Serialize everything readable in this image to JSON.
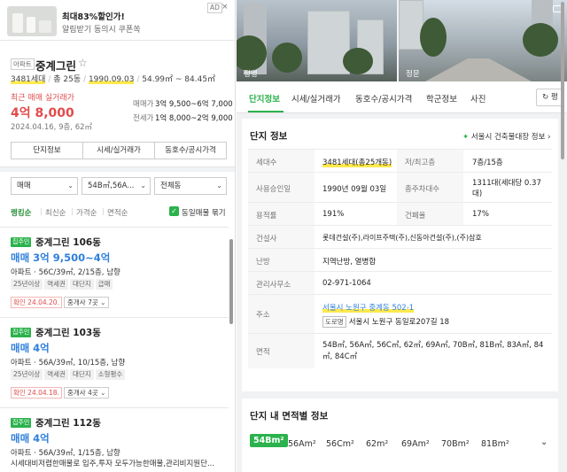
{
  "ad": {
    "title": "최대83%할인가!",
    "subtitle": "알림받기 동의시 쿠폰쏙",
    "badge": "AD",
    "close": "×"
  },
  "property": {
    "type_tag": "아파트",
    "name": "중계그린",
    "star": "☆",
    "info": {
      "households": "3481세대",
      "buildings": "총 25동",
      "approval": "1990.09.03",
      "area": "54.99㎡ ~ 84.45㎡"
    },
    "recent_label": "최근 매매 실거래가",
    "recent_price": "4억 8,000",
    "recent_date": "2024.04.16, 9층, 62㎡",
    "sale_label": "매매가",
    "sale_range": "3억 9,500~6억 7,000",
    "jeonse_label": "전세가",
    "jeonse_range": "1억 8,000~2억 9,000"
  },
  "action_buttons": [
    "단지정보",
    "시세/실거래가",
    "동호수/공시가격"
  ],
  "filters": {
    "trade": "매매",
    "area": "54B㎡,56A...",
    "building": "전체동"
  },
  "sort": {
    "options": [
      "랭킹순",
      "최신순",
      "가격순",
      "면적순"
    ],
    "active": "랭킹순",
    "group_label": "동일매물 묶기",
    "check": "✓"
  },
  "listings": [
    {
      "badge": "집주인",
      "name": "중계그린 106동",
      "price": "매매 3억 9,500~4억",
      "spec": "아파트 · 56C/39㎡, 2/15층, 남향",
      "tags": [
        "25년이상",
        "역세권",
        "대단지",
        "급매"
      ],
      "confirm": "확인 24.04.20.",
      "broker": "중개사 7곳"
    },
    {
      "badge": "집주인",
      "name": "중계그린 103동",
      "price": "매매 4억",
      "spec": "아파트 · 56A/39㎡, 10/15층, 남향",
      "tags": [
        "25년이상",
        "역세권",
        "대단지",
        "소형평수"
      ],
      "confirm": "확인 24.04.18.",
      "broker": "중개사 4곳"
    },
    {
      "badge": "집주인",
      "name": "중계그린 112동",
      "price": "매매 4억",
      "spec": "아파트 · 56A/39㎡, 1/15층, 남향",
      "desc": "시세대비저렴한매물로 입주,투자 모두가능한매물,관리비지원단..."
    }
  ],
  "photos": {
    "left_label": "정명",
    "right_label": "정문"
  },
  "tabs": [
    "단지정보",
    "시세/실거래가",
    "동호수/공시가격",
    "학군정보",
    "사진"
  ],
  "tab_active": "단지정보",
  "tab_more": "평",
  "complex_info": {
    "title": "단지 정보",
    "link": "서울시 건축물대장 정보",
    "link_arrow": "›",
    "rows": {
      "households_label": "세대수",
      "households": "3481세대(총25개동)",
      "floors_label": "저/최고층",
      "floors": "7층/15층",
      "approval_label": "사용승인일",
      "approval": "1990년 09월 03일",
      "parking_label": "총주차대수",
      "parking": "1311대(세대당 0.37대)",
      "far_label": "용적률",
      "far": "191%",
      "bcr_label": "건폐율",
      "bcr": "17%",
      "builder_label": "건설사",
      "builder": "롯데건설(주),라이프주택(주),신동아건설(주),(주)삼호",
      "heating_label": "난방",
      "heating": "지역난방, 열병합",
      "office_label": "관리사무소",
      "office": "02-971-1064",
      "address_label": "주소",
      "address": "서울시 노원구 중계동 502-1",
      "road_badge": "도로명",
      "road_address": "서울시 노원구 동일로207길 18",
      "area_label": "면적",
      "areas": "54B㎡, 56A㎡, 56C㎡, 62㎡, 69A㎡, 70B㎡, 81B㎡, 83A㎡, 84㎡, 84C㎡"
    }
  },
  "area_section": {
    "title": "단지 내 면적별 정보",
    "chips": [
      "54B",
      "56A",
      "56C",
      "62",
      "69A",
      "70B",
      "81B"
    ],
    "unit": "m²",
    "active": "54B",
    "chevron": "⌄"
  }
}
